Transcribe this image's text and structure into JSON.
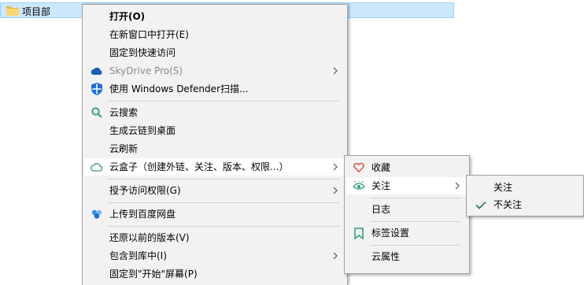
{
  "explorer": {
    "selected_file": "项目部"
  },
  "context_menu": {
    "open": "打开(O)",
    "open_new_window": "在新窗口中打开(E)",
    "pin_quick_access": "固定到快速访问",
    "skydrive": "SkyDrive Pro(S)",
    "defender_scan": "使用 Windows Defender扫描...",
    "cloud_search": "云搜索",
    "cloud_link_desktop": "生成云链到桌面",
    "cloud_refresh": "云刷新",
    "cloud_box": "云盒子（创建外链、关注、版本、权限...）",
    "grant_access": "授予访问权限(G)",
    "upload_baidu": "上传到百度网盘",
    "restore_versions": "还原以前的版本(V)",
    "include_library": "包含到库中(I)",
    "pin_start": "固定到\"开始\"屏幕(P)"
  },
  "cloud_box_menu": {
    "favorite": "收藏",
    "follow": "关注",
    "log": "日志",
    "tag_settings": "标签设置",
    "cloud_properties": "云属性"
  },
  "follow_menu": {
    "follow": "关注",
    "unfollow": "不关注"
  },
  "colors": {
    "selection_bg": "#cce8ff",
    "menu_bg": "#f2f2f2",
    "hover_bg": "#ffffff",
    "check_green": "#2e7d5b",
    "favorite_red": "#d9534f"
  }
}
